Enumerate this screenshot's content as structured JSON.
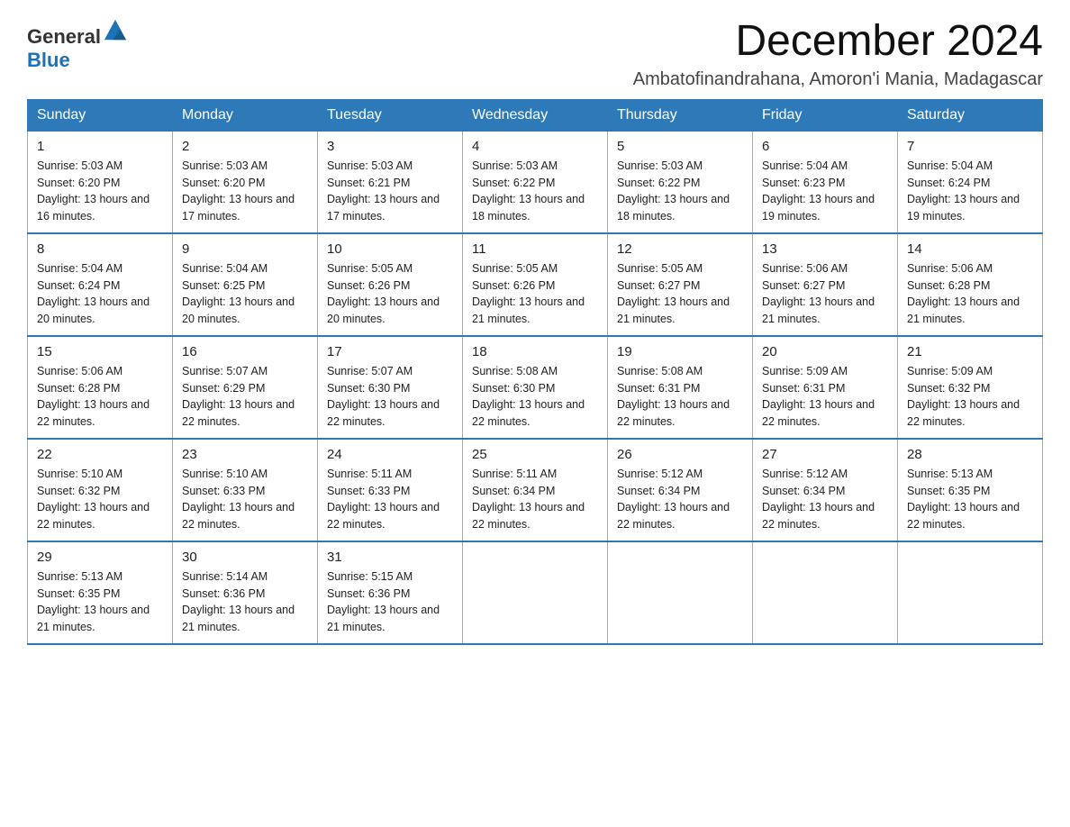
{
  "logo": {
    "text_general": "General",
    "text_blue": "Blue"
  },
  "title": "December 2024",
  "subtitle": "Ambatofinandrahana, Amoron'i Mania, Madagascar",
  "days_of_week": [
    "Sunday",
    "Monday",
    "Tuesday",
    "Wednesday",
    "Thursday",
    "Friday",
    "Saturday"
  ],
  "weeks": [
    [
      {
        "day": "1",
        "sunrise": "5:03 AM",
        "sunset": "6:20 PM",
        "daylight": "13 hours and 16 minutes."
      },
      {
        "day": "2",
        "sunrise": "5:03 AM",
        "sunset": "6:20 PM",
        "daylight": "13 hours and 17 minutes."
      },
      {
        "day": "3",
        "sunrise": "5:03 AM",
        "sunset": "6:21 PM",
        "daylight": "13 hours and 17 minutes."
      },
      {
        "day": "4",
        "sunrise": "5:03 AM",
        "sunset": "6:22 PM",
        "daylight": "13 hours and 18 minutes."
      },
      {
        "day": "5",
        "sunrise": "5:03 AM",
        "sunset": "6:22 PM",
        "daylight": "13 hours and 18 minutes."
      },
      {
        "day": "6",
        "sunrise": "5:04 AM",
        "sunset": "6:23 PM",
        "daylight": "13 hours and 19 minutes."
      },
      {
        "day": "7",
        "sunrise": "5:04 AM",
        "sunset": "6:24 PM",
        "daylight": "13 hours and 19 minutes."
      }
    ],
    [
      {
        "day": "8",
        "sunrise": "5:04 AM",
        "sunset": "6:24 PM",
        "daylight": "13 hours and 20 minutes."
      },
      {
        "day": "9",
        "sunrise": "5:04 AM",
        "sunset": "6:25 PM",
        "daylight": "13 hours and 20 minutes."
      },
      {
        "day": "10",
        "sunrise": "5:05 AM",
        "sunset": "6:26 PM",
        "daylight": "13 hours and 20 minutes."
      },
      {
        "day": "11",
        "sunrise": "5:05 AM",
        "sunset": "6:26 PM",
        "daylight": "13 hours and 21 minutes."
      },
      {
        "day": "12",
        "sunrise": "5:05 AM",
        "sunset": "6:27 PM",
        "daylight": "13 hours and 21 minutes."
      },
      {
        "day": "13",
        "sunrise": "5:06 AM",
        "sunset": "6:27 PM",
        "daylight": "13 hours and 21 minutes."
      },
      {
        "day": "14",
        "sunrise": "5:06 AM",
        "sunset": "6:28 PM",
        "daylight": "13 hours and 21 minutes."
      }
    ],
    [
      {
        "day": "15",
        "sunrise": "5:06 AM",
        "sunset": "6:28 PM",
        "daylight": "13 hours and 22 minutes."
      },
      {
        "day": "16",
        "sunrise": "5:07 AM",
        "sunset": "6:29 PM",
        "daylight": "13 hours and 22 minutes."
      },
      {
        "day": "17",
        "sunrise": "5:07 AM",
        "sunset": "6:30 PM",
        "daylight": "13 hours and 22 minutes."
      },
      {
        "day": "18",
        "sunrise": "5:08 AM",
        "sunset": "6:30 PM",
        "daylight": "13 hours and 22 minutes."
      },
      {
        "day": "19",
        "sunrise": "5:08 AM",
        "sunset": "6:31 PM",
        "daylight": "13 hours and 22 minutes."
      },
      {
        "day": "20",
        "sunrise": "5:09 AM",
        "sunset": "6:31 PM",
        "daylight": "13 hours and 22 minutes."
      },
      {
        "day": "21",
        "sunrise": "5:09 AM",
        "sunset": "6:32 PM",
        "daylight": "13 hours and 22 minutes."
      }
    ],
    [
      {
        "day": "22",
        "sunrise": "5:10 AM",
        "sunset": "6:32 PM",
        "daylight": "13 hours and 22 minutes."
      },
      {
        "day": "23",
        "sunrise": "5:10 AM",
        "sunset": "6:33 PM",
        "daylight": "13 hours and 22 minutes."
      },
      {
        "day": "24",
        "sunrise": "5:11 AM",
        "sunset": "6:33 PM",
        "daylight": "13 hours and 22 minutes."
      },
      {
        "day": "25",
        "sunrise": "5:11 AM",
        "sunset": "6:34 PM",
        "daylight": "13 hours and 22 minutes."
      },
      {
        "day": "26",
        "sunrise": "5:12 AM",
        "sunset": "6:34 PM",
        "daylight": "13 hours and 22 minutes."
      },
      {
        "day": "27",
        "sunrise": "5:12 AM",
        "sunset": "6:34 PM",
        "daylight": "13 hours and 22 minutes."
      },
      {
        "day": "28",
        "sunrise": "5:13 AM",
        "sunset": "6:35 PM",
        "daylight": "13 hours and 22 minutes."
      }
    ],
    [
      {
        "day": "29",
        "sunrise": "5:13 AM",
        "sunset": "6:35 PM",
        "daylight": "13 hours and 21 minutes."
      },
      {
        "day": "30",
        "sunrise": "5:14 AM",
        "sunset": "6:36 PM",
        "daylight": "13 hours and 21 minutes."
      },
      {
        "day": "31",
        "sunrise": "5:15 AM",
        "sunset": "6:36 PM",
        "daylight": "13 hours and 21 minutes."
      },
      null,
      null,
      null,
      null
    ]
  ]
}
